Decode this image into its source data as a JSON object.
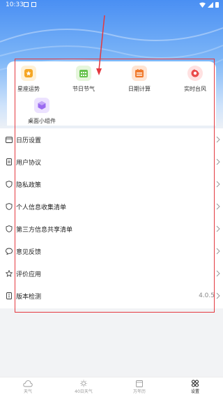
{
  "status_bar": {
    "time": "10:33"
  },
  "features": [
    {
      "label": "星座运势",
      "icon": "star-badge-icon",
      "color": "#f5a623",
      "bg": "#fff1d6"
    },
    {
      "label": "节日节气",
      "icon": "calendar-grid-icon",
      "color": "#66c24d",
      "bg": "#e6f6dc"
    },
    {
      "label": "日期计算",
      "icon": "calendar-calc-icon",
      "color": "#f07a2d",
      "bg": "#ffe4d2"
    },
    {
      "label": "实时台风",
      "icon": "typhoon-icon",
      "color": "#ea4b4b",
      "bg": "#ffe1e1"
    },
    {
      "label": "桌面小组件",
      "icon": "widget-cube-icon",
      "color": "#9b6bf0",
      "bg": "#ece2ff"
    }
  ],
  "settings": [
    {
      "label": "日历设置",
      "icon": "calendar-icon",
      "value": ""
    },
    {
      "label": "用户协议",
      "icon": "document-icon",
      "value": ""
    },
    {
      "label": "隐私政策",
      "icon": "shield-icon",
      "value": ""
    },
    {
      "label": "个人信息收集清单",
      "icon": "shield-icon",
      "value": ""
    },
    {
      "label": "第三方信息共享清单",
      "icon": "shield-icon",
      "value": ""
    },
    {
      "label": "意见反馈",
      "icon": "chat-bubble-icon",
      "value": ""
    },
    {
      "label": "评价应用",
      "icon": "star-outline-icon",
      "value": ""
    },
    {
      "label": "版本检测",
      "icon": "info-document-icon",
      "value": "4.0.5"
    }
  ],
  "tabs": [
    {
      "label": "天气",
      "icon": "cloud-icon",
      "active": false
    },
    {
      "label": "40日天气",
      "icon": "sun-icon",
      "active": false
    },
    {
      "label": "万年历",
      "icon": "calendar-tab-icon",
      "active": false
    },
    {
      "label": "设置",
      "icon": "settings-grid-icon",
      "active": true
    }
  ],
  "colors": {
    "accent": "#e4383f",
    "header_top": "#4a8ff3",
    "text": "#222222",
    "muted": "#999999"
  }
}
